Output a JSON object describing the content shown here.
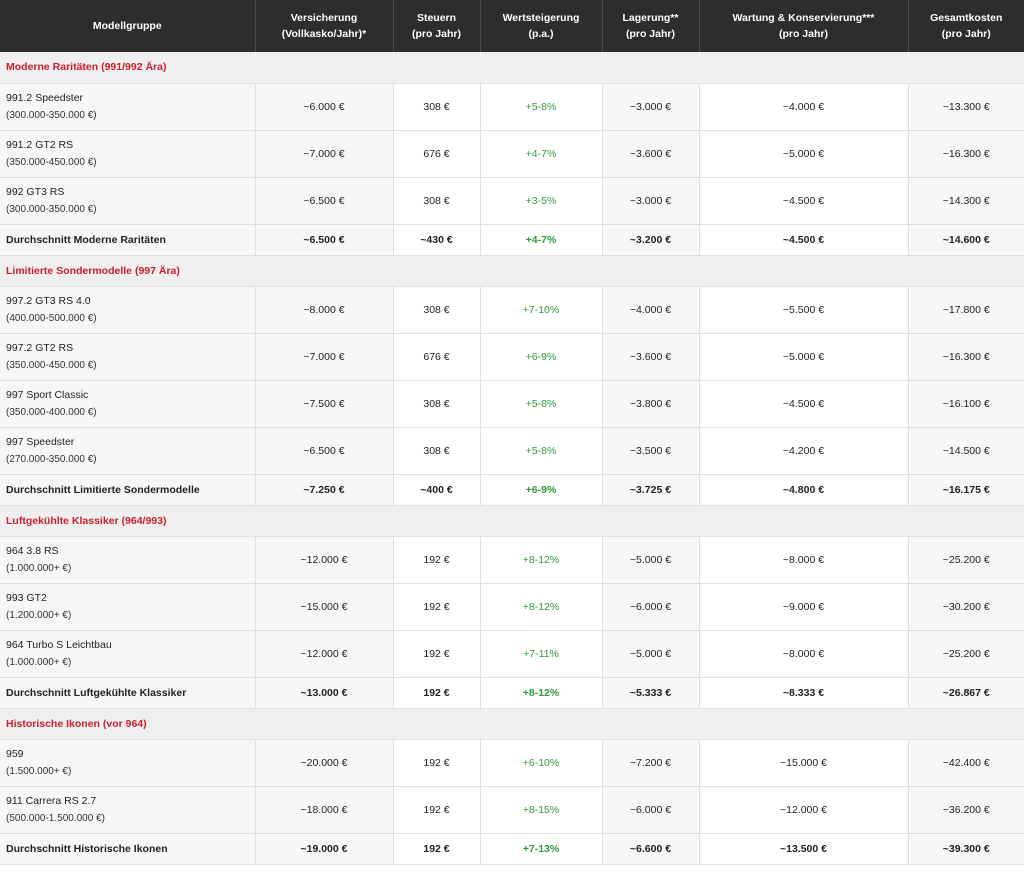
{
  "headers": [
    {
      "line1": "Modellgruppe",
      "line2": ""
    },
    {
      "line1": "Versicherung",
      "line2": "(Vollkasko/Jahr)*"
    },
    {
      "line1": "Steuern",
      "line2": "(pro Jahr)"
    },
    {
      "line1": "Wertsteigerung",
      "line2": "(p.a.)"
    },
    {
      "line1": "Lagerung**",
      "line2": "(pro Jahr)"
    },
    {
      "line1": "Wartung & Konservierung***",
      "line2": "(pro Jahr)"
    },
    {
      "line1": "Gesamtkosten",
      "line2": "(pro Jahr)"
    }
  ],
  "groups": [
    {
      "title": "Moderne Raritäten (991/992 Ära)",
      "rows": [
        {
          "model": "991.2 Speedster",
          "price": "(300.000-350.000 €)",
          "insurance": "~6.000 €",
          "tax": "308 €",
          "appreciation": "+5-8%",
          "storage": "~3.000 €",
          "maintenance": "~4.000 €",
          "total": "~13.300 €"
        },
        {
          "model": "991.2 GT2 RS",
          "price": "(350.000-450.000 €)",
          "insurance": "~7.000 €",
          "tax": "676 €",
          "appreciation": "+4-7%",
          "storage": "~3.600 €",
          "maintenance": "~5.000 €",
          "total": "~16.300 €"
        },
        {
          "model": "992 GT3 RS",
          "price": "(300.000-350.000 €)",
          "insurance": "~6.500 €",
          "tax": "308 €",
          "appreciation": "+3-5%",
          "storage": "~3.000 €",
          "maintenance": "~4.500 €",
          "total": "~14.300 €"
        }
      ],
      "average": {
        "label": "Durchschnitt Moderne Raritäten",
        "insurance": "~6.500 €",
        "tax": "~430 €",
        "appreciation": "+4-7%",
        "storage": "~3.200 €",
        "maintenance": "~4.500 €",
        "total": "~14.600 €"
      }
    },
    {
      "title": "Limitierte Sondermodelle (997 Ära)",
      "rows": [
        {
          "model": "997.2 GT3 RS 4.0",
          "price": "(400.000-500.000 €)",
          "insurance": "~8.000 €",
          "tax": "308 €",
          "appreciation": "+7-10%",
          "storage": "~4.000 €",
          "maintenance": "~5.500 €",
          "total": "~17.800 €"
        },
        {
          "model": "997.2 GT2 RS",
          "price": "(350.000-450.000 €)",
          "insurance": "~7.000 €",
          "tax": "676 €",
          "appreciation": "+6-9%",
          "storage": "~3.600 €",
          "maintenance": "~5.000 €",
          "total": "~16.300 €"
        },
        {
          "model": "997 Sport Classic",
          "price": "(350.000-400.000 €)",
          "insurance": "~7.500 €",
          "tax": "308 €",
          "appreciation": "+5-8%",
          "storage": "~3.800 €",
          "maintenance": "~4.500 €",
          "total": "~16.100 €"
        },
        {
          "model": "997 Speedster",
          "price": "(270.000-350.000 €)",
          "insurance": "~6.500 €",
          "tax": "308 €",
          "appreciation": "+5-8%",
          "storage": "~3.500 €",
          "maintenance": "~4.200 €",
          "total": "~14.500 €"
        }
      ],
      "average": {
        "label": "Durchschnitt Limitierte Sondermodelle",
        "insurance": "~7.250 €",
        "tax": "~400 €",
        "appreciation": "+6-9%",
        "storage": "~3.725 €",
        "maintenance": "~4.800 €",
        "total": "~16.175 €"
      }
    },
    {
      "title": "Luftgekühlte Klassiker (964/993)",
      "rows": [
        {
          "model": "964 3.8 RS",
          "price": "(1.000.000+ €)",
          "insurance": "~12.000 €",
          "tax": "192 €",
          "appreciation": "+8-12%",
          "storage": "~5.000 €",
          "maintenance": "~8.000 €",
          "total": "~25.200 €"
        },
        {
          "model": "993 GT2",
          "price": "(1.200.000+ €)",
          "insurance": "~15.000 €",
          "tax": "192 €",
          "appreciation": "+8-12%",
          "storage": "~6.000 €",
          "maintenance": "~9.000 €",
          "total": "~30.200 €"
        },
        {
          "model": "964 Turbo S Leichtbau",
          "price": "(1.000.000+ €)",
          "insurance": "~12.000 €",
          "tax": "192 €",
          "appreciation": "+7-11%",
          "storage": "~5.000 €",
          "maintenance": "~8.000 €",
          "total": "~25.200 €"
        }
      ],
      "average": {
        "label": "Durchschnitt Luftgekühlte Klassiker",
        "insurance": "~13.000 €",
        "tax": "192 €",
        "appreciation": "+8-12%",
        "storage": "~5.333 €",
        "maintenance": "~8.333 €",
        "total": "~26.867 €"
      }
    },
    {
      "title": "Historische Ikonen (vor 964)",
      "rows": [
        {
          "model": "959",
          "price": "(1.500.000+ €)",
          "insurance": "~20.000 €",
          "tax": "192 €",
          "appreciation": "+6-10%",
          "storage": "~7.200 €",
          "maintenance": "~15.000 €",
          "total": "~42.400 €"
        },
        {
          "model": "911 Carrera RS 2.7",
          "price": "(500.000-1.500.000 €)",
          "insurance": "~18.000 €",
          "tax": "192 €",
          "appreciation": "+8-15%",
          "storage": "~6.000 €",
          "maintenance": "~12.000 €",
          "total": "~36.200 €"
        }
      ],
      "average": {
        "label": "Durchschnitt Historische Ikonen",
        "insurance": "~19.000 €",
        "tax": "192 €",
        "appreciation": "+7-13%",
        "storage": "~6.600 €",
        "maintenance": "~13.500 €",
        "total": "~39.300 €"
      }
    }
  ],
  "colors": {
    "header_bg": "#2d2d2d",
    "group_title": "#cc1f2f",
    "positive": "#2f9a3a",
    "group_bg": "#efefef"
  }
}
